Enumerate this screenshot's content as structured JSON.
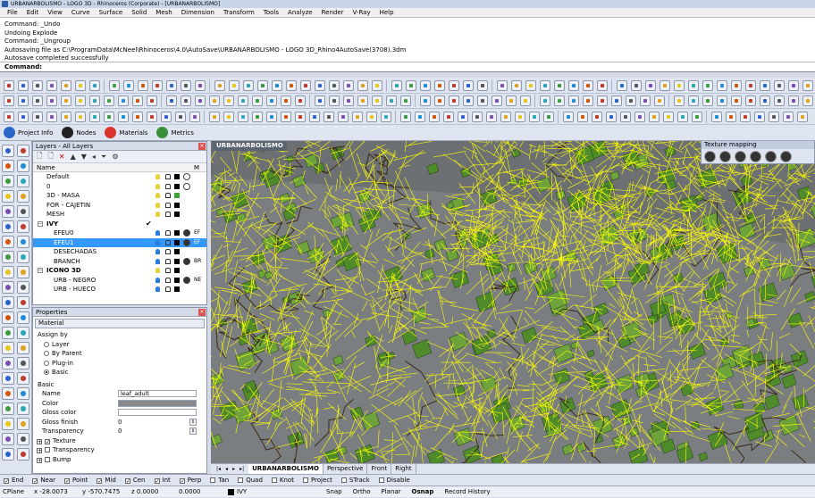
{
  "window_title": "URBANARBOLISMO - LOGO 3D - Rhinoceros (Corporate) - [URBANARBOLISMO]",
  "menu": [
    "File",
    "Edit",
    "View",
    "Curve",
    "Surface",
    "Solid",
    "Mesh",
    "Dimension",
    "Transform",
    "Tools",
    "Analyze",
    "Render",
    "V-Ray",
    "Help"
  ],
  "command_history": [
    "Command: _Undo",
    "Undoing Explode",
    "Command: _Ungroup",
    "Autosaving file as C:\\ProgramData\\McNeel\\Rhinoceros\\4.0\\AutoSave\\URBANARBOLISMO - LOGO 3D_Rhino4AutoSave(3708).3dm",
    "Autosave completed successfully"
  ],
  "command_prompt": "Command:",
  "panel_tabs": [
    {
      "label": "Project Info",
      "color": "#2a66c9"
    },
    {
      "label": "Nodes",
      "color": "#222222"
    },
    {
      "label": "Materials",
      "color": "#d8342c"
    },
    {
      "label": "Metrics",
      "color": "#3a8f3a"
    }
  ],
  "layers": {
    "title": "Layers - All Layers",
    "col_name": "Name",
    "col_m": "M",
    "rows": [
      {
        "name": "Default",
        "indent": 0,
        "tree": "",
        "check": "",
        "color": "#000000",
        "mat": ""
      },
      {
        "name": "0",
        "indent": 0,
        "tree": "",
        "check": "",
        "color": "#000000",
        "mat": ""
      },
      {
        "name": "3D - MASA",
        "indent": 0,
        "tree": "",
        "check": "",
        "color": "#3aa43a",
        "mat": ""
      },
      {
        "name": "FOR - CAJETIN",
        "indent": 0,
        "tree": "",
        "check": "",
        "color": "#000000",
        "mat": ""
      },
      {
        "name": "MESH",
        "indent": 0,
        "tree": "",
        "check": "",
        "color": "#000000",
        "mat": ""
      },
      {
        "name": "IVY",
        "indent": 0,
        "tree": "−",
        "check": "✔",
        "color": "",
        "mat": ""
      },
      {
        "name": "EFEU0",
        "indent": 1,
        "tree": "",
        "check": "",
        "color": "#000000",
        "mat": "EF"
      },
      {
        "name": "EFEU1",
        "indent": 1,
        "tree": "",
        "check": "",
        "color": "#000000",
        "mat": "EF",
        "selected": true
      },
      {
        "name": "DESECHADAS",
        "indent": 1,
        "tree": "",
        "check": "",
        "color": "#000000",
        "mat": ""
      },
      {
        "name": "BRANCH",
        "indent": 1,
        "tree": "",
        "check": "",
        "color": "#000000",
        "mat": "BR"
      },
      {
        "name": "ICONO 3D",
        "indent": 0,
        "tree": "−",
        "check": "",
        "color": "#000000",
        "mat": ""
      },
      {
        "name": "URB - NEGRO",
        "indent": 1,
        "tree": "",
        "check": "",
        "color": "#000000",
        "mat": "NE"
      },
      {
        "name": "URB - HUECO",
        "indent": 1,
        "tree": "",
        "check": "",
        "color": "#000000",
        "mat": ""
      }
    ]
  },
  "properties": {
    "title": "Properties",
    "type": "Material",
    "assign_by": "Assign by",
    "options": [
      "Layer",
      "By Parent",
      "Plug-in",
      "Basic"
    ],
    "selected_option": "Basic",
    "section_basic": "Basic",
    "name_label": "Name",
    "name_value": "leaf_adult",
    "color_label": "Color",
    "gloss_color_label": "Gloss color",
    "gloss_finish_label": "Gloss finish",
    "gloss_finish_value": "0",
    "transparency_label": "Transparency",
    "transparency_value": "0",
    "subsections": [
      "Texture",
      "Transparency",
      "Bump"
    ],
    "texture_checked": true
  },
  "viewport": {
    "label": "URBANARBOLISMO",
    "texture_mapping_title": "Texture mapping"
  },
  "view_tabs": [
    "URBANARBOLISMO",
    "Perspective",
    "Front",
    "Right"
  ],
  "active_view_tab": "URBANARBOLISMO",
  "osnaps": [
    {
      "label": "End",
      "checked": true
    },
    {
      "label": "Near",
      "checked": true
    },
    {
      "label": "Point",
      "checked": true
    },
    {
      "label": "Mid",
      "checked": true
    },
    {
      "label": "Cen",
      "checked": true
    },
    {
      "label": "Int",
      "checked": true
    },
    {
      "label": "Perp",
      "checked": true
    },
    {
      "label": "Tan",
      "checked": false
    },
    {
      "label": "Quad",
      "checked": false
    },
    {
      "label": "Knot",
      "checked": false
    },
    {
      "label": "Project",
      "checked": false
    },
    {
      "label": "STrack",
      "checked": false
    },
    {
      "label": "Disable",
      "checked": false
    }
  ],
  "status": {
    "cplane": "CPlane",
    "x": "x -28.0073",
    "y": "y -570.7475",
    "z": "z 0.0000",
    "value": "0.0000",
    "layer": "IVY",
    "toggles": [
      "Snap",
      "Ortho",
      "Planar",
      "Osnap",
      "Record History"
    ],
    "bold_toggle": "Osnap"
  },
  "colors": {
    "ivy_lines": "#ffff00",
    "leaf": "#4f8a2b",
    "viewport_bg": "#7b7e80",
    "selection": "#3399ff"
  }
}
